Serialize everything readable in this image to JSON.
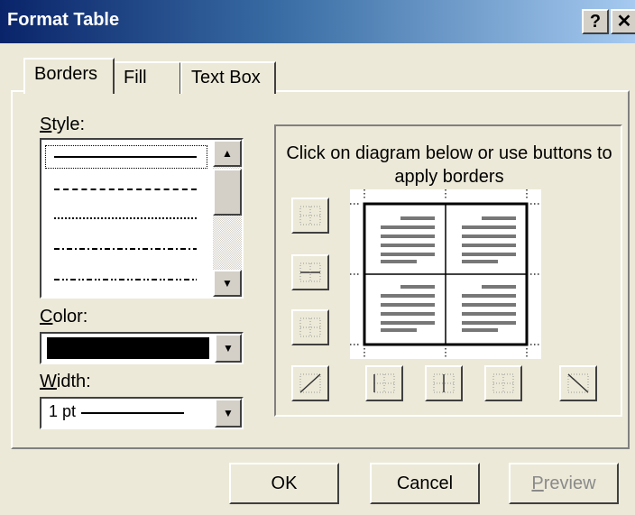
{
  "window": {
    "title": "Format Table",
    "help_glyph": "?",
    "close_glyph": "✕"
  },
  "tabs": [
    {
      "label": "Borders",
      "active": true
    },
    {
      "label": "Fill",
      "active": false
    },
    {
      "label": "Text Box",
      "active": false
    }
  ],
  "style": {
    "label_accel": "S",
    "label_rest": "tyle:",
    "line_styles": [
      "solid",
      "dashed",
      "dotted",
      "dash-dot",
      "dash-dot-dot"
    ],
    "selected_index": 0
  },
  "color": {
    "label_accel": "C",
    "label_rest": "olor:",
    "value": "#000000"
  },
  "width": {
    "label_accel": "W",
    "label_rest": "idth:",
    "value": "1 pt"
  },
  "preview_area": {
    "instruction": "Click on diagram below or use buttons to apply borders",
    "border_buttons": [
      "top-border-icon",
      "inside-horizontal-border-icon",
      "bottom-border-icon",
      "diagonal-up-icon",
      "left-border-icon",
      "inside-vertical-border-icon",
      "right-border-icon",
      "diagonal-down-icon"
    ]
  },
  "buttons": {
    "ok": "OK",
    "cancel": "Cancel",
    "preview_accel": "P",
    "preview_rest": "review",
    "preview_enabled": false
  },
  "colors": {
    "title_start": "#0a246a",
    "title_end": "#a6caf0",
    "dialog_bg": "#ece9d8"
  }
}
